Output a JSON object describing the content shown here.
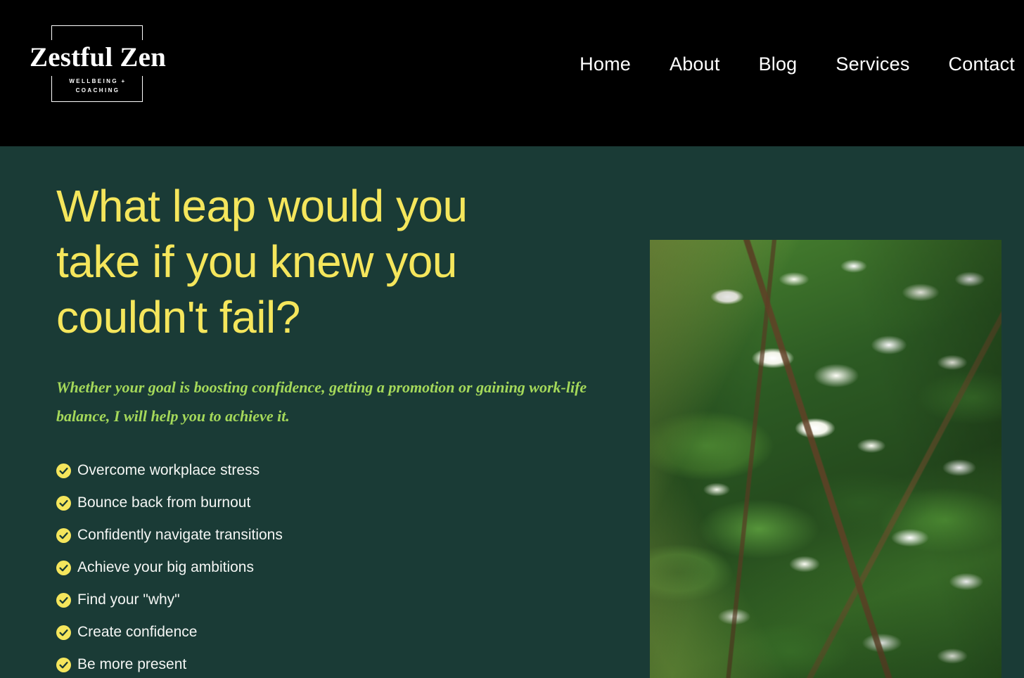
{
  "theme": {
    "header_bg": "#000000",
    "hero_bg": "#1a3b36",
    "headline_color": "#f5e65c",
    "subhead_color": "#a5d95a",
    "body_text_color": "#f4f6f4",
    "check_badge_color": "#f5e65c",
    "check_mark_color": "#1a3b36"
  },
  "header": {
    "logo": {
      "wordmark": "Zestful Zen",
      "tagline": "WELLBEING + COACHING"
    },
    "nav": [
      {
        "label": "Home"
      },
      {
        "label": "About"
      },
      {
        "label": "Blog"
      },
      {
        "label": "Services"
      },
      {
        "label": "Contact"
      }
    ]
  },
  "hero": {
    "title": "What leap would you take if you knew you couldn't fail?",
    "subtitle": "Whether your goal is boosting confidence, getting a promotion or gaining work-life balance, I will help you to achieve it.",
    "benefits": [
      {
        "label": "Overcome workplace stress"
      },
      {
        "label": "Bounce back from burnout"
      },
      {
        "label": "Confidently navigate transitions"
      },
      {
        "label": "Achieve your big ambitions"
      },
      {
        "label": "Find your \"why\""
      },
      {
        "label": "Create confidence"
      },
      {
        "label": "Be more present"
      }
    ],
    "image": {
      "alt": "Star jasmine vine with white flowers and green leaves"
    }
  }
}
